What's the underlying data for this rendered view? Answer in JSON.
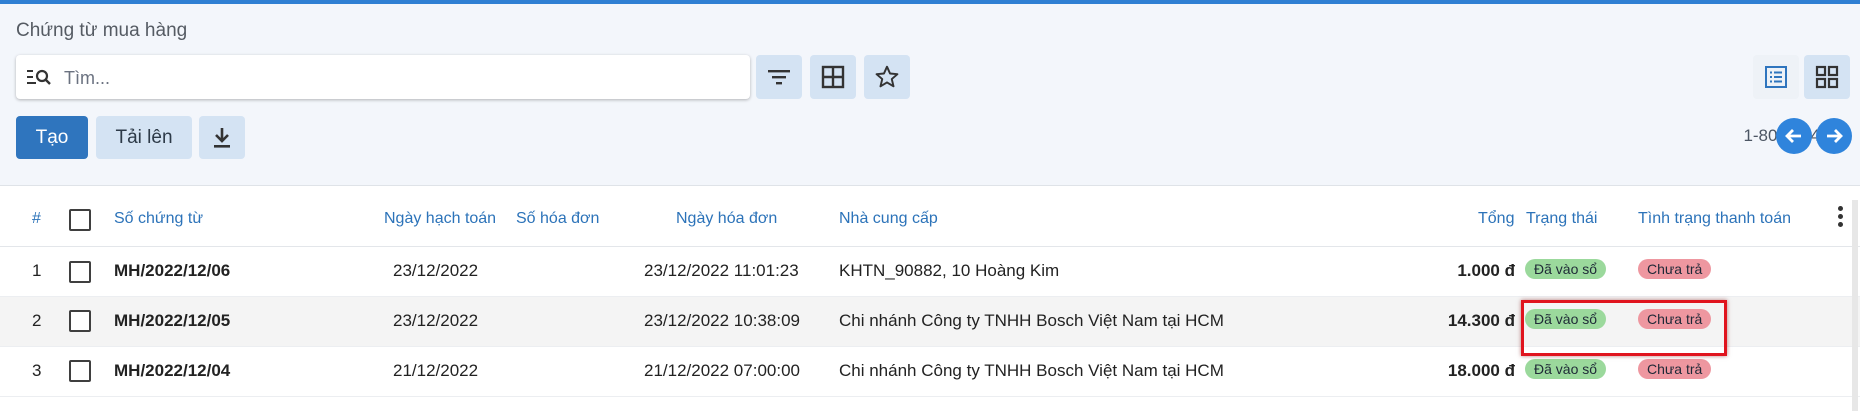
{
  "breadcrumb": "Chứng từ mua hàng",
  "search": {
    "placeholder": "Tìm..."
  },
  "toolbar": {
    "create_label": "Tạo",
    "upload_label": "Tải lên"
  },
  "pager": {
    "text": "1-80 / 184"
  },
  "colors": {
    "accent": "#2f75be",
    "status_posted": "#9bd99c",
    "status_unpaid": "#ee97a0",
    "highlight": "#e0141e"
  },
  "table": {
    "headers": {
      "index": "#",
      "doc_no": "Số chứng từ",
      "post_date": "Ngày hạch toán",
      "invoice_no": "Số hóa đơn",
      "invoice_date": "Ngày hóa đơn",
      "supplier": "Nhà cung cấp",
      "total": "Tổng",
      "status": "Trạng thái",
      "payment": "Tình trạng thanh toán"
    },
    "rows": [
      {
        "index": "1",
        "doc_no": "MH/2022/12/06",
        "post_date": "23/12/2022",
        "invoice_no": "",
        "invoice_date": "23/12/2022 11:01:23",
        "supplier": "KHTN_90882, 10 Hoàng Kim",
        "total": "1.000 đ",
        "status": "Đã vào sổ",
        "payment": "Chưa trả"
      },
      {
        "index": "2",
        "doc_no": "MH/2022/12/05",
        "post_date": "23/12/2022",
        "invoice_no": "",
        "invoice_date": "23/12/2022 10:38:09",
        "supplier": "Chi nhánh Công ty TNHH Bosch Việt Nam tại HCM",
        "total": "14.300 đ",
        "status": "Đã vào sổ",
        "payment": "Chưa trả"
      },
      {
        "index": "3",
        "doc_no": "MH/2022/12/04",
        "post_date": "21/12/2022",
        "invoice_no": "",
        "invoice_date": "21/12/2022 07:00:00",
        "supplier": "Chi nhánh Công ty TNHH Bosch Việt Nam tại HCM",
        "total": "18.000 đ",
        "status": "Đã vào sổ",
        "payment": "Chưa trả"
      }
    ]
  },
  "icons": {
    "search": "search-list-icon",
    "filter": "filter-icon",
    "group": "grid-table-icon",
    "favorite": "star-icon",
    "download": "download-icon",
    "list_view": "list-view-icon",
    "kanban_view": "kanban-view-icon",
    "prev": "arrow-left-icon",
    "next": "arrow-right-icon"
  }
}
